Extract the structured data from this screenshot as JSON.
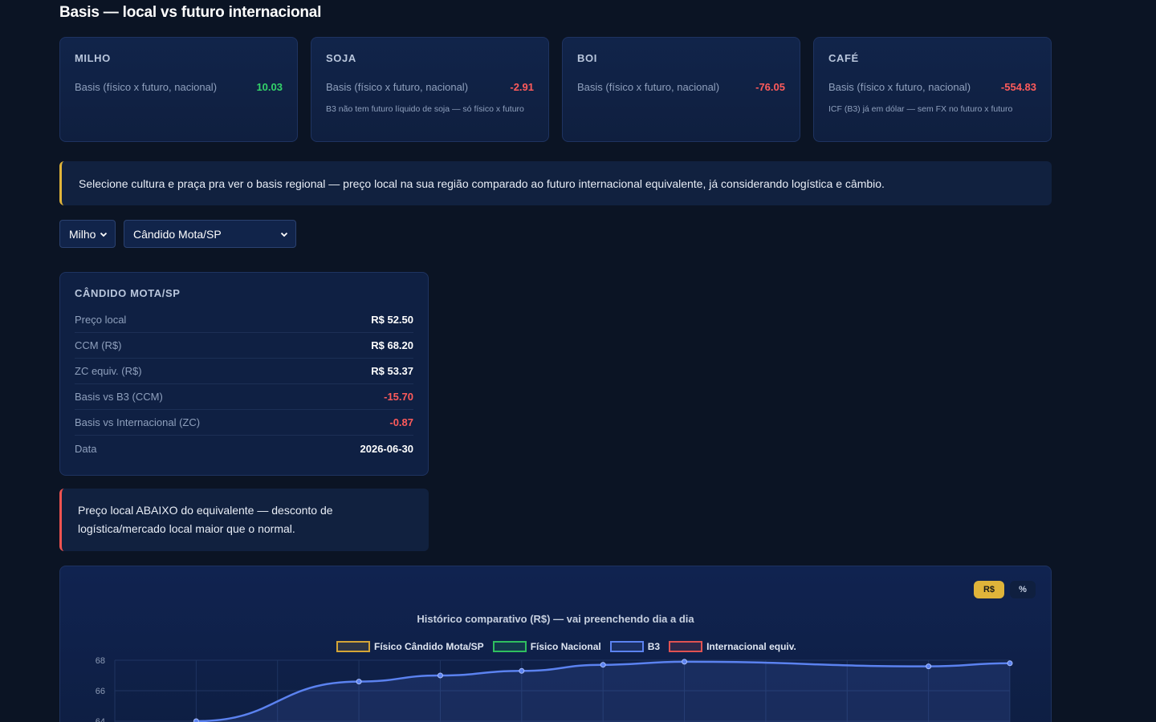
{
  "page": {
    "title": "Basis — local vs futuro internacional"
  },
  "cards": [
    {
      "name": "MILHO",
      "label": "Basis (físico x futuro, nacional)",
      "value": "10.03",
      "sign": "pos",
      "note": ""
    },
    {
      "name": "SOJA",
      "label": "Basis (físico x futuro, nacional)",
      "value": "-2.91",
      "sign": "neg",
      "note": "B3 não tem futuro líquido de soja — só físico x futuro"
    },
    {
      "name": "BOI",
      "label": "Basis (físico x futuro, nacional)",
      "value": "-76.05",
      "sign": "neg",
      "note": ""
    },
    {
      "name": "CAFÉ",
      "label": "Basis (físico x futuro, nacional)",
      "value": "-554.83",
      "sign": "neg",
      "note": "ICF (B3) já em dólar — sem FX no futuro x futuro"
    }
  ],
  "info_banner": "Selecione cultura e praça pra ver o basis regional — preço local na sua região comparado ao futuro internacional equivalente, já considerando logística e câmbio.",
  "filters": {
    "crop": "Milho",
    "location": "Cândido Mota/SP"
  },
  "detail": {
    "title": "CÂNDIDO MOTA/SP",
    "rows": [
      {
        "label": "Preço local",
        "value": "R$ 52.50",
        "color": "#ffffff"
      },
      {
        "label": "CCM (R$)",
        "value": "R$ 68.20",
        "color": "#ffffff"
      },
      {
        "label": "ZC equiv. (R$)",
        "value": "R$ 53.37",
        "color": "#ffffff"
      },
      {
        "label": "Basis vs B3 (CCM)",
        "value": "-15.70",
        "color": "#ff5b5b"
      },
      {
        "label": "Basis vs Internacional (ZC)",
        "value": "-0.87",
        "color": "#ff5b5b"
      },
      {
        "label": "Data",
        "value": "2026-06-30",
        "color": "#ffffff"
      }
    ]
  },
  "alert": "Preço local ABAIXO do equivalente — desconto de logística/mercado local maior que o normal.",
  "chart_toggle": {
    "rs": "R$",
    "pct": "%"
  },
  "chart_data": {
    "type": "line",
    "title": "Histórico comparativo (R$) — vai preenchendo dia a dia",
    "series": [
      {
        "name": "Físico Cândido Mota/SP",
        "color": "#d4a537",
        "values": []
      },
      {
        "name": "Físico Nacional",
        "color": "#2fbf5f",
        "values": []
      },
      {
        "name": "B3",
        "color": "#5b82f0",
        "values": [
          null,
          64.0,
          null,
          66.6,
          67.0,
          67.3,
          67.7,
          67.9,
          null,
          null,
          67.6,
          67.8
        ]
      },
      {
        "name": "Internacional equiv.",
        "color": "#e05252",
        "values": []
      }
    ],
    "y_ticks": [
      "68",
      "66",
      "64"
    ],
    "ylim": [
      64,
      68
    ],
    "grid": true,
    "legend": "top"
  }
}
